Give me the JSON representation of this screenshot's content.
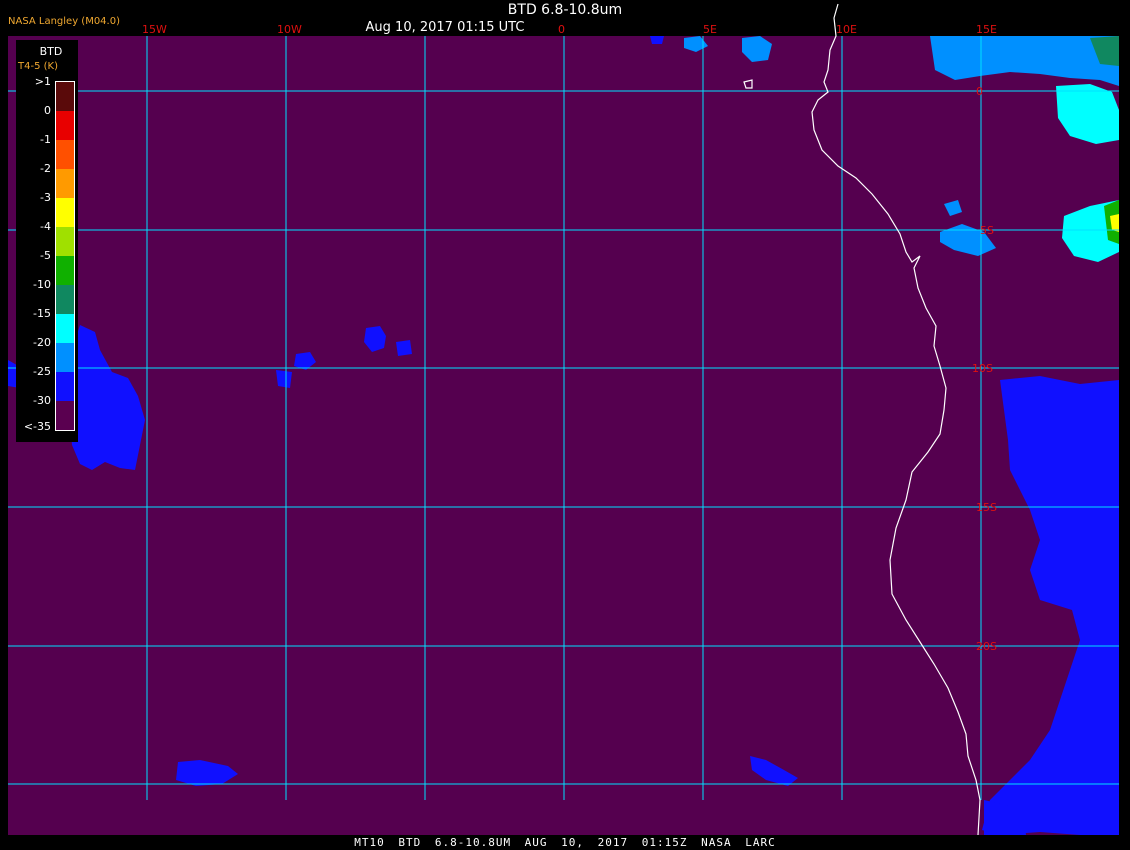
{
  "header": {
    "title": "BTD 6.8-10.8um",
    "subtitle": "Aug 10, 2017 01:15 UTC",
    "provider": "NASA Langley (M04.0)"
  },
  "footer": {
    "caption": "MT10 BTD 6.8-10.8UM AUG 10, 2017 01:15Z NASA LARC"
  },
  "legend": {
    "title": "BTD",
    "unit": "T4-5 (K)",
    "labels": [
      ">1",
      "0",
      "-1",
      "-2",
      "-3",
      "-4",
      "-5",
      "-10",
      "-15",
      "-20",
      "-25",
      "-30",
      "<-35"
    ],
    "colors": [
      "#5a0a0a",
      "#e80000",
      "#ff5000",
      "#ff9a00",
      "#ffff00",
      "#a0e000",
      "#10b000",
      "#108860",
      "#00ffff",
      "#0090ff",
      "#1010ff",
      "#5a0050"
    ]
  },
  "map": {
    "background_color": "#55004f",
    "grid_color": "#00e0ff",
    "coast_color": "#ffffff",
    "longitude_labels": [
      "15W",
      "10W",
      "0",
      "5E",
      "10E",
      "15E"
    ],
    "latitude_labels": [
      "0",
      "5S",
      "10S",
      "15S",
      "20S"
    ],
    "cloud_colors": {
      "low": "#1010ff",
      "mid": "#0090ff",
      "cyan": "#00ffff",
      "teal": "#108860",
      "green": "#10b000",
      "yellow": "#ffff00"
    }
  }
}
